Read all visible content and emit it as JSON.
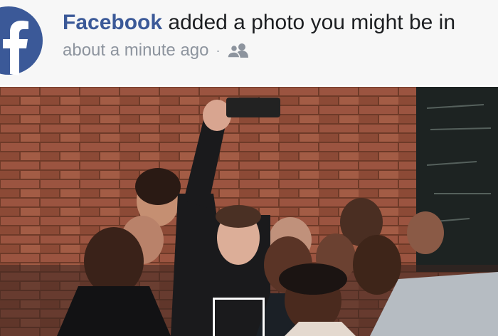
{
  "notification": {
    "actor": "Facebook",
    "action": "added a photo you might be in",
    "timestamp": "about a minute ago",
    "separator": "·",
    "audience_icon": "friends-icon"
  },
  "brand": {
    "logo_icon": "facebook-logo-icon",
    "accent_color": "#3b5998"
  },
  "photo": {
    "face_tag_box": "suggested-tag-face-box"
  }
}
